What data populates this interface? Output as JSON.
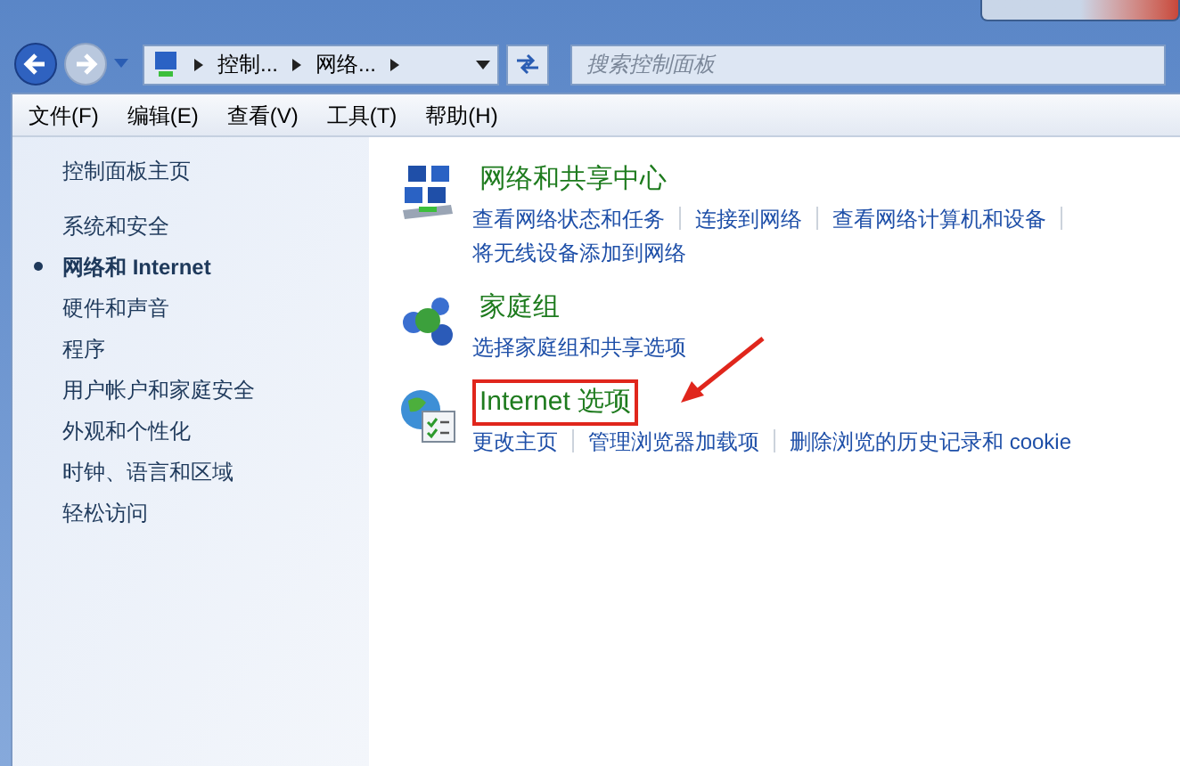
{
  "address_bar": {
    "crumbs": [
      "控制...",
      "网络..."
    ]
  },
  "search": {
    "placeholder": "搜索控制面板"
  },
  "menu": [
    "文件(F)",
    "编辑(E)",
    "查看(V)",
    "工具(T)",
    "帮助(H)"
  ],
  "sidebar": {
    "home": "控制面板主页",
    "items": [
      {
        "label": "系统和安全",
        "selected": false
      },
      {
        "label": "网络和 Internet",
        "selected": true
      },
      {
        "label": "硬件和声音",
        "selected": false
      },
      {
        "label": "程序",
        "selected": false
      },
      {
        "label": "用户帐户和家庭安全",
        "selected": false
      },
      {
        "label": "外观和个性化",
        "selected": false
      },
      {
        "label": "时钟、语言和区域",
        "selected": false
      },
      {
        "label": "轻松访问",
        "selected": false
      }
    ]
  },
  "categories": [
    {
      "kind": "network",
      "title": "网络和共享中心",
      "highlighted": false,
      "links": [
        [
          "查看网络状态和任务",
          "连接到网络",
          "查看网络计算机和设备"
        ],
        [
          "将无线设备添加到网络"
        ]
      ]
    },
    {
      "kind": "homegroup",
      "title": "家庭组",
      "highlighted": false,
      "links": [
        [
          "选择家庭组和共享选项"
        ]
      ]
    },
    {
      "kind": "internet",
      "title": "Internet 选项",
      "highlighted": true,
      "links": [
        [
          "更改主页",
          "管理浏览器加载项",
          "删除浏览的历史记录和 cookie"
        ]
      ]
    }
  ]
}
